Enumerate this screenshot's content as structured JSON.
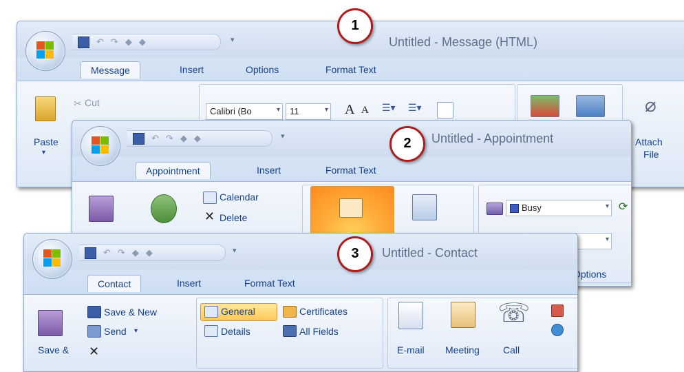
{
  "markers": [
    "1",
    "2",
    "3"
  ],
  "window1": {
    "title": "Untitled - Message (HTML)",
    "tabs": [
      "Message",
      "Insert",
      "Options",
      "Format Text"
    ],
    "paste_label": "Paste",
    "cut_label": "Cut",
    "font_name": "Calibri (Bo",
    "font_size": "11",
    "attach_label_1": "Attach",
    "attach_label_2": "File"
  },
  "window2": {
    "title": "Untitled - Appointment",
    "tabs": [
      "Appointment",
      "Insert",
      "Format Text"
    ],
    "calendar_label": "Calendar",
    "delete_label": "Delete",
    "show_as_value": "Busy",
    "options_group_label": "Options"
  },
  "window3": {
    "title": "Untitled - Contact",
    "tabs": [
      "Contact",
      "Insert",
      "Format Text"
    ],
    "save_new_label": "Save & New",
    "send_label": "Send",
    "save_close_label": "Save &",
    "general_label": "General",
    "certificates_label": "Certificates",
    "details_label": "Details",
    "all_fields_label": "All Fields",
    "email_label": "E-mail",
    "meeting_label": "Meeting",
    "call_label": "Call"
  }
}
